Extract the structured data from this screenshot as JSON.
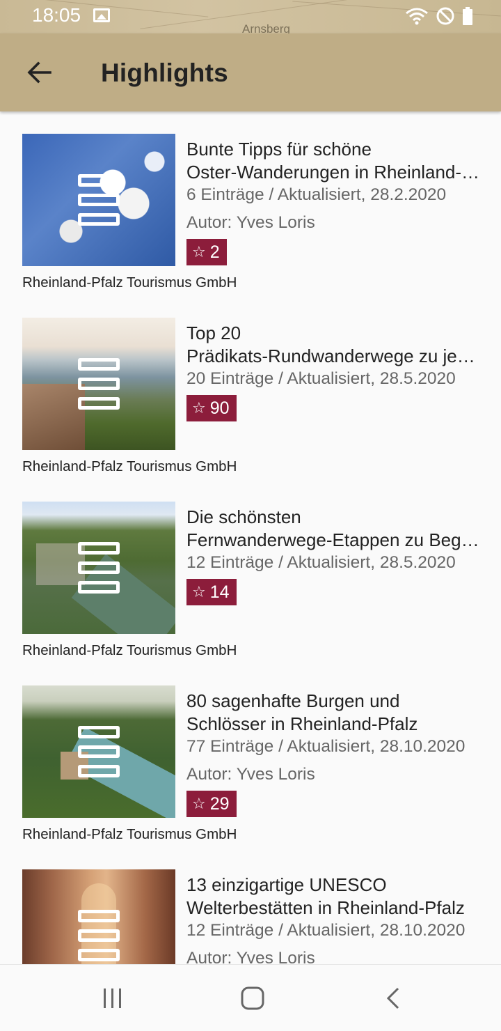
{
  "status_bar": {
    "time": "18:05",
    "map_label": "Arnsberg"
  },
  "app_bar": {
    "title": "Highlights",
    "back_icon": "arrow-back-icon"
  },
  "items": [
    {
      "title_line1": "Bunte Tipps für schöne",
      "title_line2": "Oster-Wanderungen in Rheinland-Pfalz",
      "meta": "6 Einträge / Aktualisiert, 28.2.2020",
      "author": "Autor: Yves Loris",
      "rating": "2",
      "publisher": "Rheinland-Pfalz Tourismus GmbH"
    },
    {
      "title_line1": "Top 20",
      "title_line2": "Prädikats-Rundwanderwege zu jeder Jahreszeit",
      "meta": "20 Einträge / Aktualisiert, 28.5.2020",
      "author": "",
      "rating": "90",
      "publisher": "Rheinland-Pfalz Tourismus GmbH"
    },
    {
      "title_line1": "Die schönsten",
      "title_line2": "Fernwanderwege-Etappen zu Beginn",
      "meta": "12 Einträge / Aktualisiert, 28.5.2020",
      "author": "",
      "rating": "14",
      "publisher": "Rheinland-Pfalz Tourismus GmbH"
    },
    {
      "title_line1": "80 sagenhafte Burgen und",
      "title_line2": "Schlösser in Rheinland-Pfalz",
      "meta": "77 Einträge / Aktualisiert, 28.10.2020",
      "author": "Autor: Yves Loris",
      "rating": "29",
      "publisher": "Rheinland-Pfalz Tourismus GmbH"
    },
    {
      "title_line1": "13 einzigartige UNESCO",
      "title_line2": "Welterbestätten in Rheinland-Pfalz",
      "meta": "12 Einträge / Aktualisiert, 28.10.2020",
      "author": "Autor: Yves Loris",
      "rating": "",
      "publisher": ""
    }
  ],
  "nav_bar": {
    "recents_icon": "recents-icon",
    "home_icon": "home-icon",
    "back_icon": "nav-back-icon"
  },
  "colors": {
    "app_bar": "#bfad86",
    "badge": "#8c1d3b"
  }
}
